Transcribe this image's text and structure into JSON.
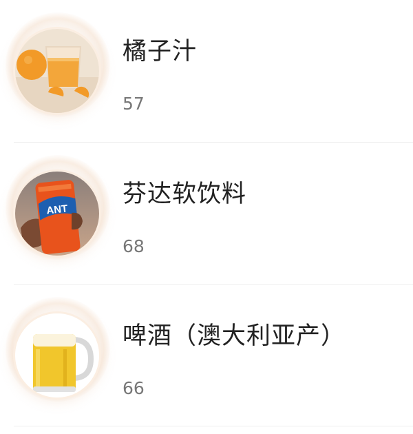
{
  "items": [
    {
      "name": "橘子汁",
      "count": "57",
      "image": "orange-juice-photo"
    },
    {
      "name": "芬达软饮料",
      "count": "68",
      "image": "fanta-can-photo"
    },
    {
      "name": "啤酒（澳大利亚产）",
      "count": "66",
      "image": "beer-mug-photo"
    }
  ],
  "colors": {
    "title": "#222222",
    "count": "#777777",
    "divider": "#eeeeee",
    "avatar_ring": "#fbeee2"
  }
}
